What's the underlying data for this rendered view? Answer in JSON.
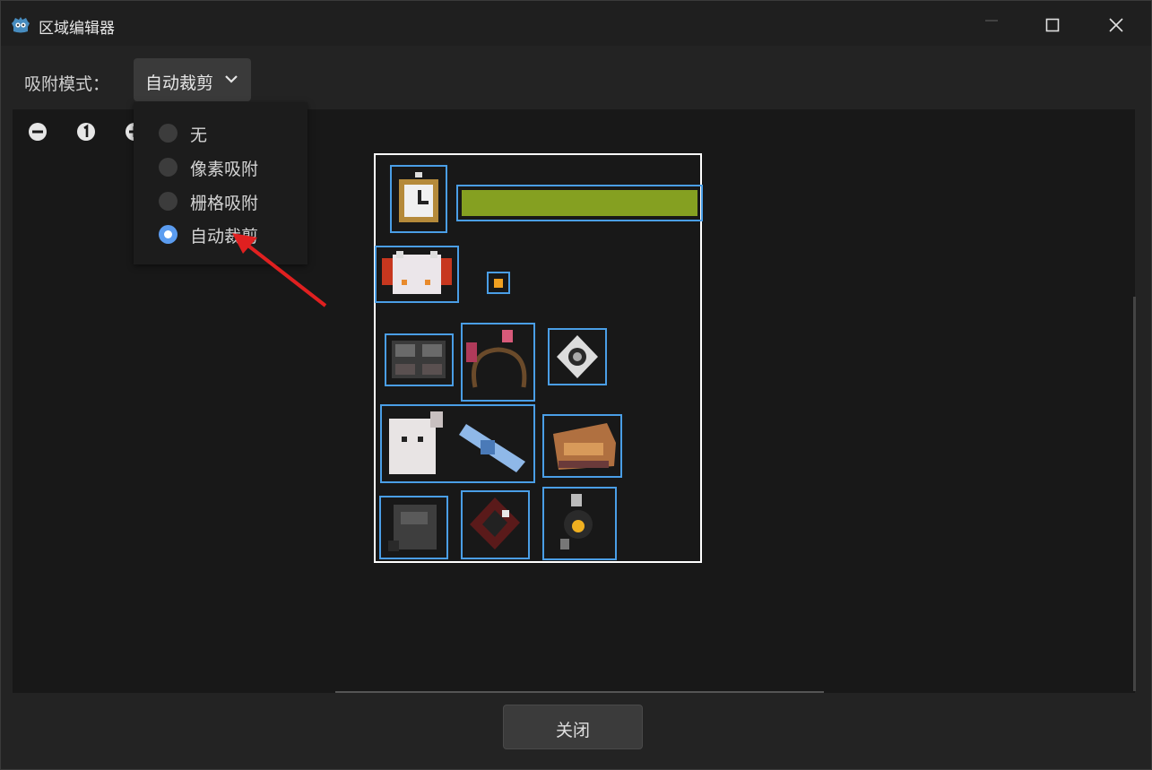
{
  "window": {
    "title": "区域编辑器",
    "icons": [
      "godot-icon",
      "minimize-icon",
      "maximize-icon",
      "close-icon"
    ]
  },
  "toolbar": {
    "snap_label": "吸附模式：",
    "snap_mode_selected": "自动裁剪",
    "zoom_icons": [
      "zoom-out-icon",
      "zoom-reset-icon",
      "zoom-in-icon"
    ]
  },
  "snap_menu": {
    "options": [
      {
        "label": "无",
        "selected": false
      },
      {
        "label": "像素吸附",
        "selected": false
      },
      {
        "label": "栅格吸附",
        "selected": false
      },
      {
        "label": "自动裁剪",
        "selected": true
      }
    ]
  },
  "footer": {
    "close_label": "关闭"
  },
  "colors": {
    "accent": "#5b9cf0",
    "region_border": "#4a9ee6",
    "atlas_border": "#ffffff",
    "annotation_arrow": "#e02020"
  }
}
